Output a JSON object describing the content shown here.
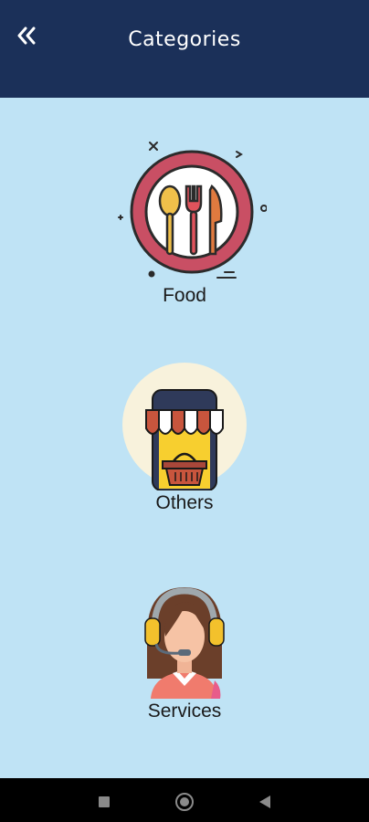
{
  "header": {
    "title": "Categories",
    "back_icon": "double-chevron-left-icon",
    "background": "#1b3059"
  },
  "main": {
    "background": "#bfe3f5",
    "categories": [
      {
        "label": "Food",
        "icon": "plate-cutlery-icon"
      },
      {
        "label": "Others",
        "icon": "storefront-basket-icon"
      },
      {
        "label": "Services",
        "icon": "support-agent-headset-icon"
      }
    ]
  },
  "navbar": {
    "items": [
      {
        "icon": "recents-square-icon"
      },
      {
        "icon": "home-circle-icon"
      },
      {
        "icon": "back-triangle-icon"
      }
    ]
  }
}
